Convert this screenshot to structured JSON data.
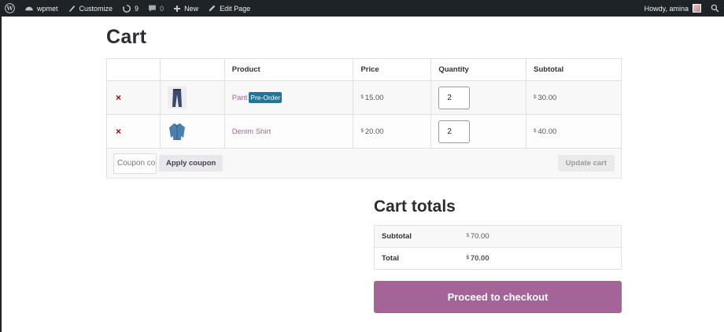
{
  "adminbar": {
    "site_name": "wpmet",
    "customize": "Customize",
    "updates_count": "9",
    "comments_count": "0",
    "new_label": "New",
    "edit_page": "Edit Page",
    "howdy": "Howdy, amina"
  },
  "page": {
    "title": "Cart"
  },
  "cart": {
    "headers": {
      "remove": "",
      "thumb": "",
      "product": "Product",
      "price": "Price",
      "quantity": "Quantity",
      "subtotal": "Subtotal"
    },
    "currency_symbol": "$",
    "items": [
      {
        "remove": "×",
        "name": "Pant",
        "badge": "Pre-Order",
        "price": "15.00",
        "quantity": "2",
        "subtotal": "30.00"
      },
      {
        "remove": "×",
        "name": "Denim Shirt",
        "badge": "",
        "price": "20.00",
        "quantity": "2",
        "subtotal": "40.00"
      }
    ],
    "coupon_placeholder": "Coupon code",
    "apply_coupon": "Apply coupon",
    "update_cart": "Update cart"
  },
  "totals": {
    "title": "Cart totals",
    "subtotal_label": "Subtotal",
    "subtotal_value": "70.00",
    "total_label": "Total",
    "total_value": "70.00",
    "checkout_label": "Proceed to checkout"
  },
  "colors": {
    "accent": "#a46497",
    "badge": "#21759b",
    "adminbar": "#1d2327"
  }
}
